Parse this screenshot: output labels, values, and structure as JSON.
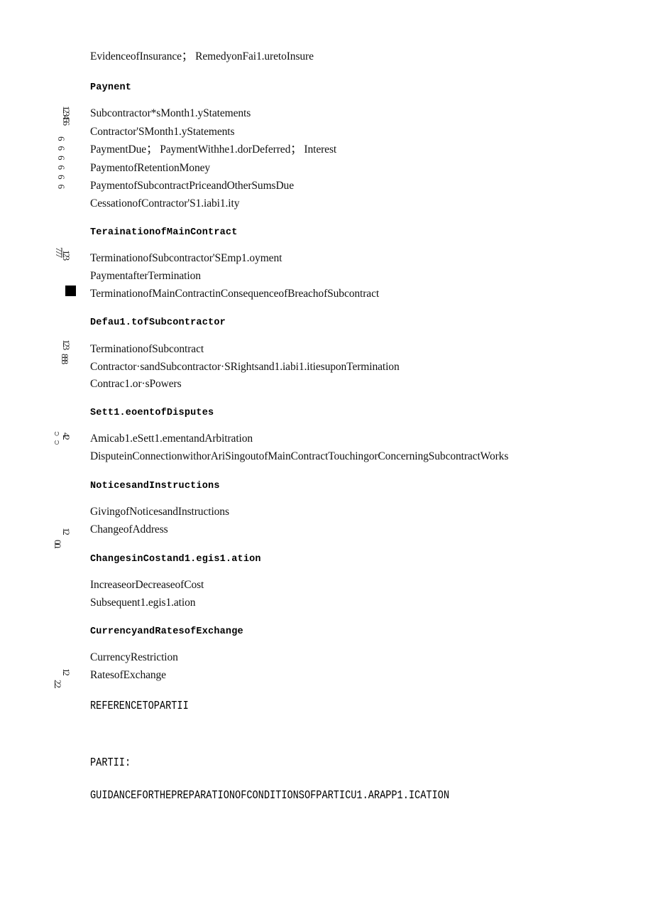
{
  "document": {
    "type": "scanned-contract-table-of-contents",
    "top_line": "EvidenceofInsurance；  RemedyonFai1.uretoInsure"
  },
  "sections": [
    {
      "heading": "Paynent",
      "items": [
        "Subcontractor*sMonth1.yStatements",
        "Contractor'SMonth1.yStatements",
        "PaymentDue；  PaymentWithhe1.dorDeferred；  Interest",
        "PaymentofRetentionMoney",
        "PaymentofSubcontractPriceandOtherSumsDue",
        "CessationofContractor'S1.iabi1.ity"
      ],
      "margin_digits": "123456",
      "margin_digits2": "666666"
    },
    {
      "heading": "TerainationofMainContract",
      "items": [
        "TerminationofSubcontractor'SEmp1.oyment",
        "PaymentafterTermination",
        "TerminationofMainContractinConsequenceofBreachofSubcontract"
      ],
      "margin_digits": "123",
      "margin_digits2": "777"
    },
    {
      "heading": "Defau1.tofSubcontractor",
      "items": [
        "TerminationofSubcontract",
        "Contractor·sandSubcontractor·SRightsand1.iabi1.itiesuponTermination",
        "Contrac1.or·sPowers"
      ],
      "margin_digits": "123",
      "margin_digits2": "888"
    },
    {
      "heading": "Sett1.eoentofDisputes",
      "items": [
        "Amicab1.eSett1.ementandArbitration",
        "DisputeinConnectionwithorAriSingoutofMainContractTouchingorConcerningSubcontractWorks"
      ],
      "margin_digits": "42",
      "margin_digits2": "၁၁"
    },
    {
      "heading": "NoticesandInstructions",
      "items": [
        "GivingofNoticesandInstructions",
        "ChangeofAddress"
      ],
      "margin_digits": "12",
      "margin_digits2": "0.0."
    },
    {
      "heading": "ChangesinCostand1.egis1.ation",
      "items": [
        "IncreaseorDecreaseofCost",
        "Subsequent1.egis1.ation"
      ],
      "margin_digits": "",
      "margin_digits2": ""
    },
    {
      "heading": "CurrencyandRatesofExchange",
      "items": [
        "CurrencyRestriction",
        "RatesofExchange"
      ],
      "margin_digits": "12",
      "margin_digits2": "2.2."
    }
  ],
  "footer": {
    "reference": "REFERENCETOPARTII",
    "part_label": "PARTII:",
    "guidance": "GUIDANCEFORTHEPREPARATIONOFCONDITIONSOFPARTICU1.ARAPP1.ICATION"
  }
}
